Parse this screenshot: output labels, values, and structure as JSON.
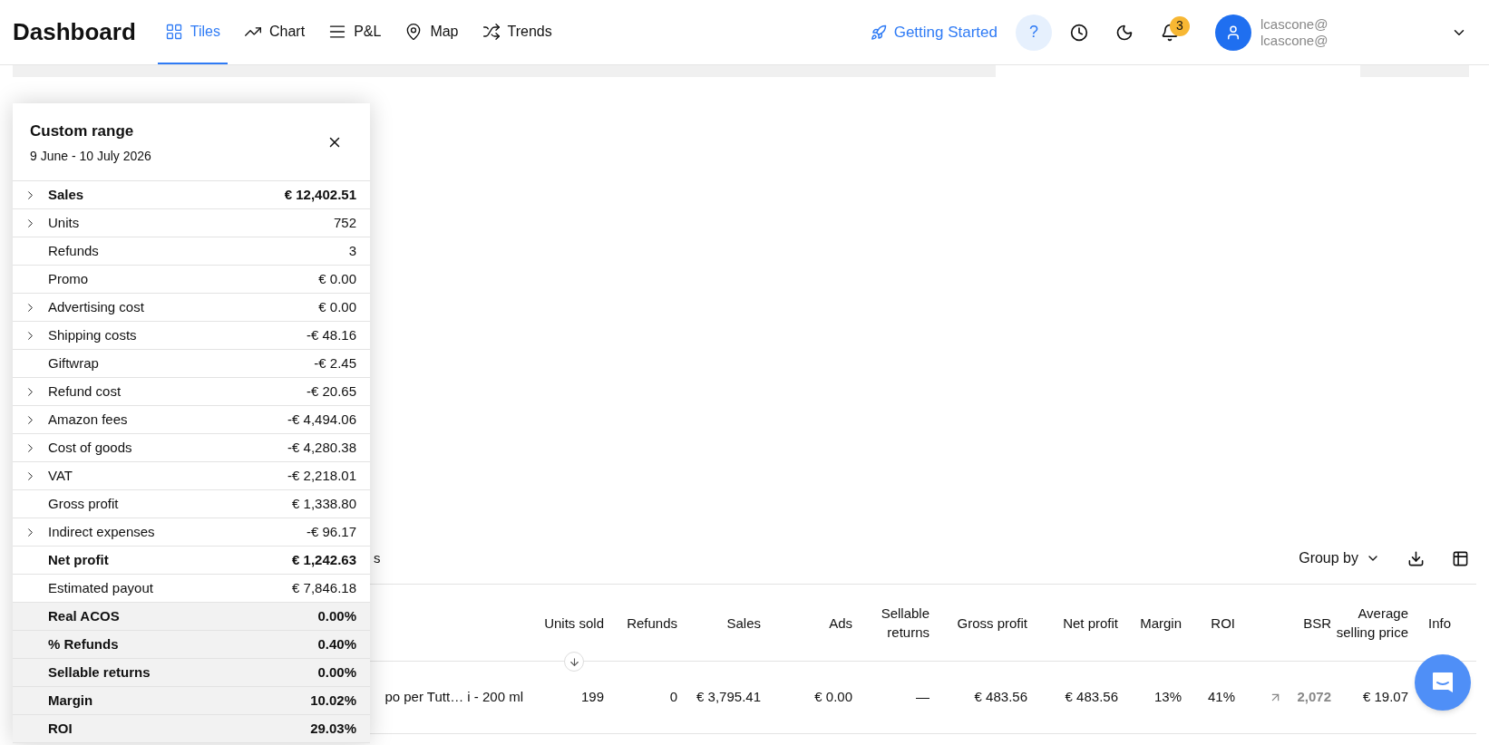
{
  "header": {
    "title": "Dashboard",
    "tabs": [
      {
        "label": "Tiles",
        "selected": true
      },
      {
        "label": "Chart",
        "selected": false
      },
      {
        "label": "P&L",
        "selected": false
      },
      {
        "label": "Map",
        "selected": false
      },
      {
        "label": "Trends",
        "selected": false
      }
    ],
    "getting_started": "Getting Started",
    "help": "?",
    "notifications": "3",
    "user": {
      "email_1": "lcascone@",
      "email_2": "lcascone@"
    }
  },
  "panel": {
    "title": "Custom range",
    "subtitle": "9 June - 10 July 2026",
    "rows": [
      {
        "label": "Sales",
        "value": "€ 12,402.51",
        "kind": "bold",
        "expandable": true
      },
      {
        "label": "Units",
        "value": "752",
        "kind": "plain",
        "expandable": true
      },
      {
        "label": "Refunds",
        "value": "3",
        "kind": "plain",
        "expandable": false
      },
      {
        "label": "Promo",
        "value": "€ 0.00",
        "kind": "plain",
        "expandable": false
      },
      {
        "label": "Advertising cost",
        "value": "€ 0.00",
        "kind": "plain",
        "expandable": true
      },
      {
        "label": "Shipping costs",
        "value": "-€ 48.16",
        "kind": "plain",
        "expandable": true
      },
      {
        "label": "Giftwrap",
        "value": "-€ 2.45",
        "kind": "plain",
        "expandable": false
      },
      {
        "label": "Refund cost",
        "value": "-€ 20.65",
        "kind": "plain",
        "expandable": true
      },
      {
        "label": "Amazon fees",
        "value": "-€ 4,494.06",
        "kind": "plain",
        "expandable": true
      },
      {
        "label": "Cost of goods",
        "value": "-€ 4,280.38",
        "kind": "plain",
        "expandable": true
      },
      {
        "label": "VAT",
        "value": "-€ 2,218.01",
        "kind": "plain",
        "expandable": true
      },
      {
        "label": "Gross profit",
        "value": "€ 1,338.80",
        "kind": "plain",
        "expandable": false
      },
      {
        "label": "Indirect expenses",
        "value": "-€ 96.17",
        "kind": "plain",
        "expandable": true
      },
      {
        "label": "Net profit",
        "value": "€ 1,242.63",
        "kind": "bold",
        "expandable": false
      },
      {
        "label": "Estimated payout",
        "value": "€ 7,846.18",
        "kind": "plain",
        "expandable": false
      },
      {
        "label": "Real ACOS",
        "value": "0.00%",
        "kind": "metric",
        "expandable": false
      },
      {
        "label": "% Refunds",
        "value": "0.40%",
        "kind": "metric",
        "expandable": false
      },
      {
        "label": "Sellable returns",
        "value": "0.00%",
        "kind": "metric",
        "expandable": false
      },
      {
        "label": "Margin",
        "value": "10.02%",
        "kind": "metric",
        "expandable": false
      },
      {
        "label": "ROI",
        "value": "29.03%",
        "kind": "metric",
        "expandable": false
      }
    ]
  },
  "products": {
    "title_fragment": "s",
    "group_by": "Group by",
    "table": {
      "columns": [
        "Units sold",
        "Refunds",
        "Sales",
        "Ads",
        "Sellable returns",
        "Gross profit",
        "Net profit",
        "Margin",
        "ROI",
        "BSR",
        "Average selling price",
        "Info"
      ],
      "rows": [
        {
          "product": "po per Tutt… i - 200 ml",
          "cells": [
            "199",
            "0",
            "€ 3,795.41",
            "€ 0.00",
            "—",
            "€ 483.56",
            "€ 483.56",
            "13%",
            "41%",
            "2,072",
            "€ 19.07"
          ]
        }
      ]
    }
  }
}
